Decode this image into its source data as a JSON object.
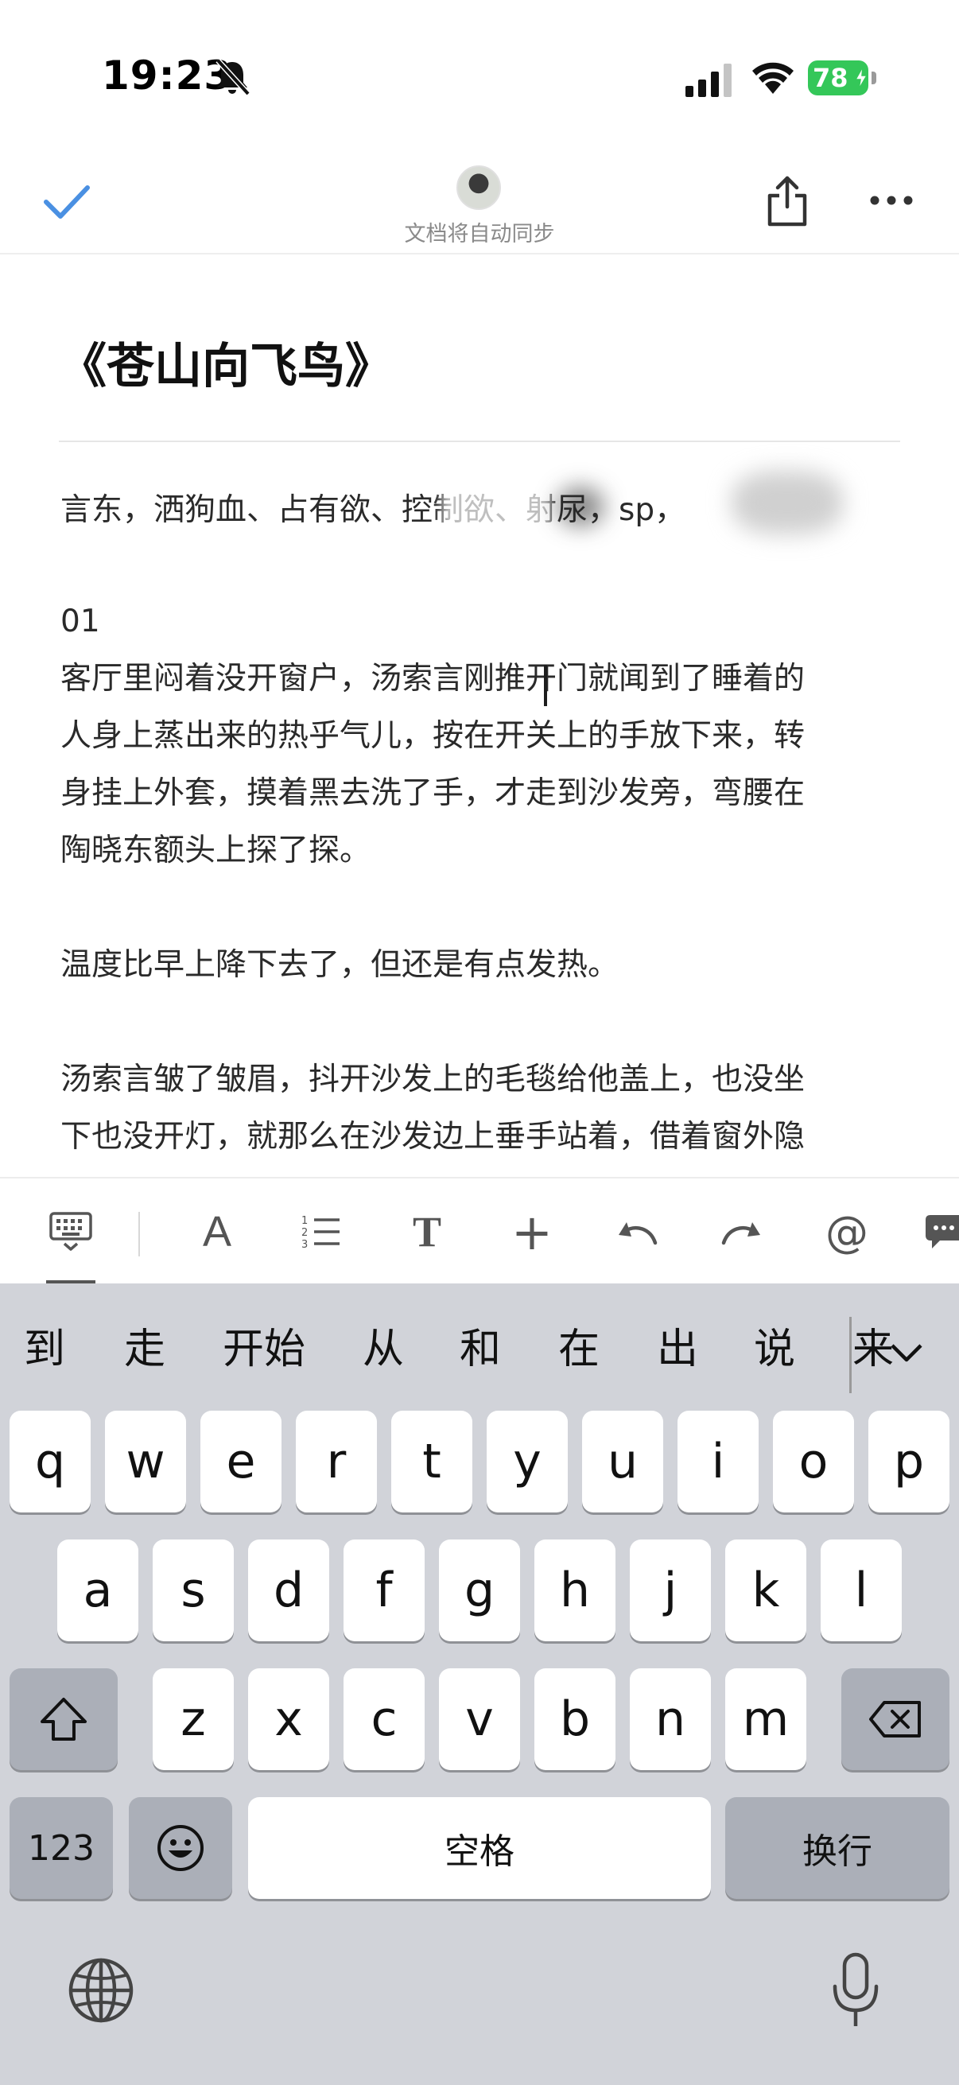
{
  "status": {
    "time": "19:23",
    "battery": "78"
  },
  "header": {
    "sync_text": "文档将自动同步"
  },
  "doc": {
    "title": "《苍山向飞鸟》",
    "tags": "言东，洒狗血、占有欲、控制欲、射尿，sp，",
    "paragraphs": [
      "01",
      "客厅里闷着没开窗户，汤索言刚推开门就闻到了睡着的",
      "人身上蒸出来的热乎气儿，按在开关上的手放下来，转",
      "身挂上外套，摸着黑去洗了手，才走到沙发旁，弯腰在",
      "陶晓东额头上探了探。",
      "温度比早上降下去了，但还是有点发热。",
      "汤索言皱了皱眉，抖开沙发上的毛毯给他盖上，也没坐",
      "下也没开灯，就那么在沙发边上垂手站着，借着窗外隐"
    ]
  },
  "toolbar": {
    "icons": [
      "keyboard-dismiss-icon",
      "text-style-icon",
      "ordered-list-icon",
      "heading-icon",
      "insert-plus-icon",
      "undo-icon",
      "redo-icon",
      "mention-icon",
      "comment-icon"
    ],
    "text_style": "A",
    "heading": "T",
    "plus": "+",
    "mention": "@"
  },
  "keyboard": {
    "candidates": [
      "到",
      "走",
      "开始",
      "从",
      "和",
      "在",
      "出",
      "说",
      "来"
    ],
    "row1": [
      "q",
      "w",
      "e",
      "r",
      "t",
      "y",
      "u",
      "i",
      "o",
      "p"
    ],
    "row2": [
      "a",
      "s",
      "d",
      "f",
      "g",
      "h",
      "j",
      "k",
      "l"
    ],
    "row3": [
      "z",
      "x",
      "c",
      "v",
      "b",
      "n",
      "m"
    ],
    "numbers_key": "123",
    "space_key": "空格",
    "return_key": "换行"
  },
  "colors": {
    "accent": "#4a90e2",
    "battery": "#34c759",
    "keyboard_bg": "#d1d3d9",
    "key_gray": "#abafb8"
  }
}
